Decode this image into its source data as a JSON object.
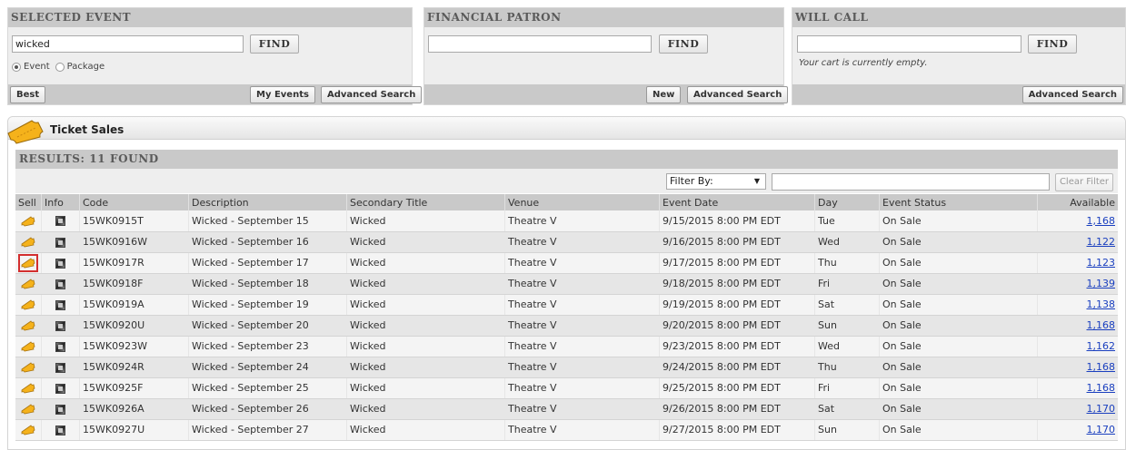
{
  "selected_event": {
    "title": "SELECTED EVENT",
    "search_value": "wicked",
    "find_label": "FIND",
    "radio_event": "Event",
    "radio_package": "Package",
    "best_label": "Best",
    "my_events_label": "My Events",
    "advanced_label": "Advanced Search"
  },
  "financial_patron": {
    "title": "FINANCIAL PATRON",
    "search_value": "",
    "find_label": "FIND",
    "new_label": "New",
    "advanced_label": "Advanced Search"
  },
  "will_call": {
    "title": "WILL CALL",
    "search_value": "",
    "find_label": "FIND",
    "cart_message": "Your cart is currently empty.",
    "advanced_label": "Advanced Search"
  },
  "ticket_sales": {
    "title": "Ticket Sales",
    "results_label": "RESULTS: 11 FOUND",
    "filter_by": "Filter By:",
    "clear_filter": "Clear Filter",
    "columns": [
      "Sell",
      "Info",
      "Code",
      "Description",
      "Secondary Title",
      "Venue",
      "Event Date",
      "Day",
      "Event Status",
      "Available"
    ],
    "rows": [
      {
        "code": "15WK0915T",
        "description": "Wicked - September 15",
        "secondary": "Wicked",
        "venue": "Theatre V",
        "date": "9/15/2015 8:00 PM EDT",
        "day": "Tue",
        "status": "On Sale",
        "available": "1,168"
      },
      {
        "code": "15WK0916W",
        "description": "Wicked - September 16",
        "secondary": "Wicked",
        "venue": "Theatre V",
        "date": "9/16/2015 8:00 PM EDT",
        "day": "Wed",
        "status": "On Sale",
        "available": "1,122"
      },
      {
        "code": "15WK0917R",
        "description": "Wicked - September 17",
        "secondary": "Wicked",
        "venue": "Theatre V",
        "date": "9/17/2015 8:00 PM EDT",
        "day": "Thu",
        "status": "On Sale",
        "available": "1,123"
      },
      {
        "code": "15WK0918F",
        "description": "Wicked - September 18",
        "secondary": "Wicked",
        "venue": "Theatre V",
        "date": "9/18/2015 8:00 PM EDT",
        "day": "Fri",
        "status": "On Sale",
        "available": "1,139"
      },
      {
        "code": "15WK0919A",
        "description": "Wicked - September 19",
        "secondary": "Wicked",
        "venue": "Theatre V",
        "date": "9/19/2015 8:00 PM EDT",
        "day": "Sat",
        "status": "On Sale",
        "available": "1,138"
      },
      {
        "code": "15WK0920U",
        "description": "Wicked - September 20",
        "secondary": "Wicked",
        "venue": "Theatre V",
        "date": "9/20/2015 8:00 PM EDT",
        "day": "Sun",
        "status": "On Sale",
        "available": "1,168"
      },
      {
        "code": "15WK0923W",
        "description": "Wicked - September 23",
        "secondary": "Wicked",
        "venue": "Theatre V",
        "date": "9/23/2015 8:00 PM EDT",
        "day": "Wed",
        "status": "On Sale",
        "available": "1,162"
      },
      {
        "code": "15WK0924R",
        "description": "Wicked - September 24",
        "secondary": "Wicked",
        "venue": "Theatre V",
        "date": "9/24/2015 8:00 PM EDT",
        "day": "Thu",
        "status": "On Sale",
        "available": "1,168"
      },
      {
        "code": "15WK0925F",
        "description": "Wicked - September 25",
        "secondary": "Wicked",
        "venue": "Theatre V",
        "date": "9/25/2015 8:00 PM EDT",
        "day": "Fri",
        "status": "On Sale",
        "available": "1,168"
      },
      {
        "code": "15WK0926A",
        "description": "Wicked - September 26",
        "secondary": "Wicked",
        "venue": "Theatre V",
        "date": "9/26/2015 8:00 PM EDT",
        "day": "Sat",
        "status": "On Sale",
        "available": "1,170"
      },
      {
        "code": "15WK0927U",
        "description": "Wicked - September 27",
        "secondary": "Wicked",
        "venue": "Theatre V",
        "date": "9/27/2015 8:00 PM EDT",
        "day": "Sun",
        "status": "On Sale",
        "available": "1,170"
      }
    ],
    "highlighted_row": 2
  },
  "colors": {
    "header_bar": "#c9c9c9",
    "panel_bg": "#eeeeee",
    "link": "#1a3fbf",
    "highlight": "#d32f2f",
    "ticket": "#f5b21b"
  }
}
